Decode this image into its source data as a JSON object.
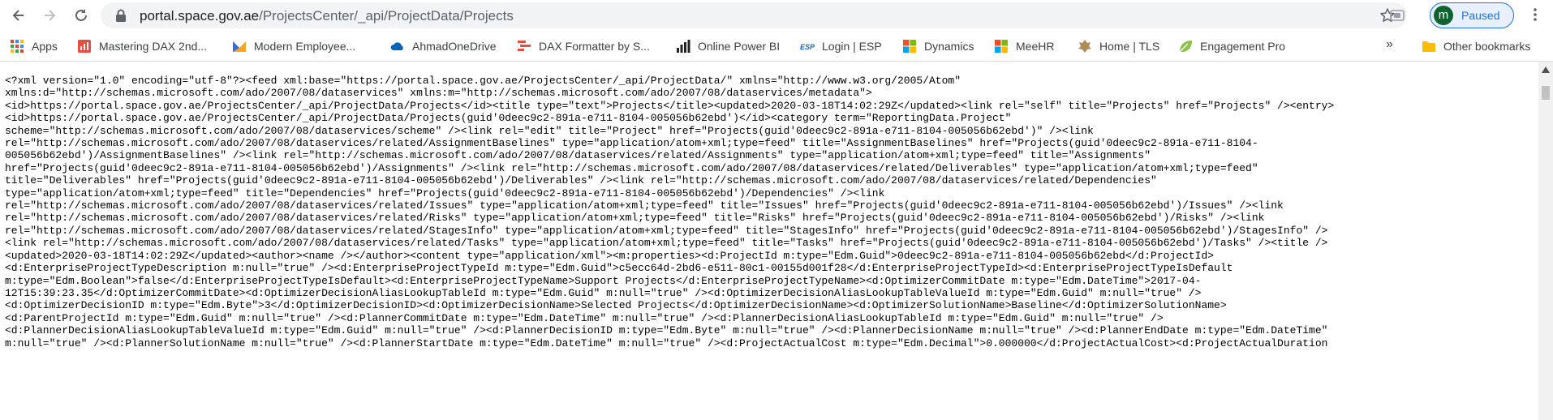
{
  "browser": {
    "url_host": "portal.space.gov.ae",
    "url_path": "/ProjectsCenter/_api/ProjectData/Projects",
    "profile_initial": "m",
    "profile_label": "Paused"
  },
  "bookmarks": {
    "items": [
      {
        "label": "Apps",
        "icon": "apps-grid-icon"
      },
      {
        "label": "Mastering DAX 2nd...",
        "icon": "sqlbi-icon"
      },
      {
        "label": "Modern Employee...",
        "icon": "m-logo-icon"
      },
      {
        "label": "AhmadOneDrive",
        "icon": "cloud-icon"
      },
      {
        "label": "DAX Formatter by S...",
        "icon": "dax-formatter-icon"
      },
      {
        "label": "Online Power BI",
        "icon": "bars-icon"
      },
      {
        "label": "Login | ESP",
        "icon": "esp-icon"
      },
      {
        "label": "Dynamics",
        "icon": "microsoft-icon"
      },
      {
        "label": "MeeHR",
        "icon": "microsoft-icon"
      },
      {
        "label": "Home | TLS",
        "icon": "emblem-icon"
      },
      {
        "label": "Engagement Pro",
        "icon": "leaf-icon"
      }
    ],
    "more": "»",
    "other": "Other bookmarks"
  },
  "xml_lines": [
    "<?xml version=\"1.0\" encoding=\"utf-8\"?><feed xml:base=\"https://portal.space.gov.ae/ProjectsCenter/_api/ProjectData/\" xmlns=\"http://www.w3.org/2005/Atom\"",
    "xmlns:d=\"http://schemas.microsoft.com/ado/2007/08/dataservices\" xmlns:m=\"http://schemas.microsoft.com/ado/2007/08/dataservices/metadata\">",
    "<id>https://portal.space.gov.ae/ProjectsCenter/_api/ProjectData/Projects</id><title type=\"text\">Projects</title><updated>2020-03-18T14:02:29Z</updated><link rel=\"self\" title=\"Projects\" href=\"Projects\" /><entry>",
    "<id>https://portal.space.gov.ae/ProjectsCenter/_api/ProjectData/Projects(guid'0deec9c2-891a-e711-8104-005056b62ebd')</id><category term=\"ReportingData.Project\"",
    "scheme=\"http://schemas.microsoft.com/ado/2007/08/dataservices/scheme\" /><link rel=\"edit\" title=\"Project\" href=\"Projects(guid'0deec9c2-891a-e711-8104-005056b62ebd')\" /><link",
    "rel=\"http://schemas.microsoft.com/ado/2007/08/dataservices/related/AssignmentBaselines\" type=\"application/atom+xml;type=feed\" title=\"AssignmentBaselines\" href=\"Projects(guid'0deec9c2-891a-e711-8104-",
    "005056b62ebd')/AssignmentBaselines\" /><link rel=\"http://schemas.microsoft.com/ado/2007/08/dataservices/related/Assignments\" type=\"application/atom+xml;type=feed\" title=\"Assignments\"",
    "href=\"Projects(guid'0deec9c2-891a-e711-8104-005056b62ebd')/Assignments\" /><link rel=\"http://schemas.microsoft.com/ado/2007/08/dataservices/related/Deliverables\" type=\"application/atom+xml;type=feed\"",
    "title=\"Deliverables\" href=\"Projects(guid'0deec9c2-891a-e711-8104-005056b62ebd')/Deliverables\" /><link rel=\"http://schemas.microsoft.com/ado/2007/08/dataservices/related/Dependencies\"",
    "type=\"application/atom+xml;type=feed\" title=\"Dependencies\" href=\"Projects(guid'0deec9c2-891a-e711-8104-005056b62ebd')/Dependencies\" /><link",
    "rel=\"http://schemas.microsoft.com/ado/2007/08/dataservices/related/Issues\" type=\"application/atom+xml;type=feed\" title=\"Issues\" href=\"Projects(guid'0deec9c2-891a-e711-8104-005056b62ebd')/Issues\" /><link",
    "rel=\"http://schemas.microsoft.com/ado/2007/08/dataservices/related/Risks\" type=\"application/atom+xml;type=feed\" title=\"Risks\" href=\"Projects(guid'0deec9c2-891a-e711-8104-005056b62ebd')/Risks\" /><link",
    "rel=\"http://schemas.microsoft.com/ado/2007/08/dataservices/related/StagesInfo\" type=\"application/atom+xml;type=feed\" title=\"StagesInfo\" href=\"Projects(guid'0deec9c2-891a-e711-8104-005056b62ebd')/StagesInfo\" />",
    "<link rel=\"http://schemas.microsoft.com/ado/2007/08/dataservices/related/Tasks\" type=\"application/atom+xml;type=feed\" title=\"Tasks\" href=\"Projects(guid'0deec9c2-891a-e711-8104-005056b62ebd')/Tasks\" /><title />",
    "<updated>2020-03-18T14:02:29Z</updated><author><name /></author><content type=\"application/xml\"><m:properties><d:ProjectId m:type=\"Edm.Guid\">0deec9c2-891a-e711-8104-005056b62ebd</d:ProjectId>",
    "<d:EnterpriseProjectTypeDescription m:null=\"true\" /><d:EnterpriseProjectTypeId m:type=\"Edm.Guid\">c5ecc64d-2bd6-e511-80c1-00155d001f28</d:EnterpriseProjectTypeId><d:EnterpriseProjectTypeIsDefault",
    "m:type=\"Edm.Boolean\">false</d:EnterpriseProjectTypeIsDefault><d:EnterpriseProjectTypeName>Support Projects</d:EnterpriseProjectTypeName><d:OptimizerCommitDate m:type=\"Edm.DateTime\">2017-04-",
    "12T15:39:23.35</d:OptimizerCommitDate><d:OptimizerDecisionAliasLookupTableId m:type=\"Edm.Guid\" m:null=\"true\" /><d:OptimizerDecisionAliasLookupTableValueId m:type=\"Edm.Guid\" m:null=\"true\" />",
    "<d:OptimizerDecisionID m:type=\"Edm.Byte\">3</d:OptimizerDecisionID><d:OptimizerDecisionName>Selected Projects</d:OptimizerDecisionName><d:OptimizerSolutionName>Baseline</d:OptimizerSolutionName>",
    "<d:ParentProjectId m:type=\"Edm.Guid\" m:null=\"true\" /><d:PlannerCommitDate m:type=\"Edm.DateTime\" m:null=\"true\" /><d:PlannerDecisionAliasLookupTableId m:type=\"Edm.Guid\" m:null=\"true\" />",
    "<d:PlannerDecisionAliasLookupTableValueId m:type=\"Edm.Guid\" m:null=\"true\" /><d:PlannerDecisionID m:type=\"Edm.Byte\" m:null=\"true\" /><d:PlannerDecisionName m:null=\"true\" /><d:PlannerEndDate m:type=\"Edm.DateTime\"",
    "m:null=\"true\" /><d:PlannerSolutionName m:null=\"true\" /><d:PlannerStartDate m:type=\"Edm.DateTime\" m:null=\"true\" /><d:ProjectActualCost m:type=\"Edm.Decimal\">0.000000</d:ProjectActualCost><d:ProjectActualDuration"
  ],
  "colors": {
    "accent": "#1a73e8",
    "toolbar_bg": "#ffffff",
    "omnibox_bg": "#f1f3f4"
  }
}
